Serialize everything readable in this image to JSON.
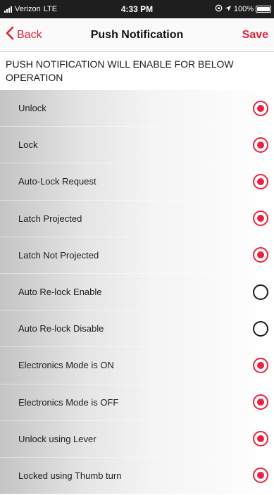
{
  "status_bar": {
    "carrier": "Verizon",
    "network": "LTE",
    "time": "4:33 PM",
    "battery": "100%",
    "battery_level": 1.0
  },
  "nav": {
    "back_label": "Back",
    "title": "Push Notification",
    "save_label": "Save"
  },
  "section": {
    "header": "PUSH NOTIFICATION WILL ENABLE FOR BELOW OPERATION"
  },
  "options": [
    {
      "label": "Unlock",
      "selected": true
    },
    {
      "label": "Lock",
      "selected": true
    },
    {
      "label": "Auto-Lock Request",
      "selected": true
    },
    {
      "label": "Latch Projected",
      "selected": true
    },
    {
      "label": "Latch Not Projected",
      "selected": true
    },
    {
      "label": "Auto Re-lock Enable",
      "selected": false
    },
    {
      "label": "Auto Re-lock Disable",
      "selected": false
    },
    {
      "label": "Electronics Mode is ON",
      "selected": true
    },
    {
      "label": "Electronics Mode is OFF",
      "selected": true
    },
    {
      "label": "Unlock using Lever",
      "selected": true
    },
    {
      "label": "Locked using Thumb turn",
      "selected": true
    }
  ],
  "colors": {
    "accent": "#e8233f",
    "status_bar_bg": "#1e1e1e"
  },
  "icons": {
    "back": "chevron-left-icon",
    "location": "location-arrow-icon",
    "orientation": "orientation-lock-icon",
    "battery": "battery-icon",
    "signal": "signal-bars-icon"
  }
}
